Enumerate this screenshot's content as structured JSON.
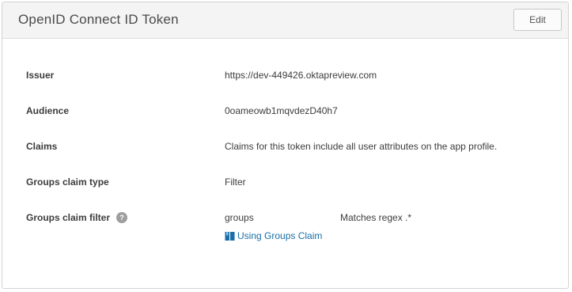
{
  "header": {
    "title": "OpenID Connect ID Token",
    "edit_label": "Edit"
  },
  "rows": [
    {
      "label": "Issuer",
      "value": "https://dev-449426.oktapreview.com"
    },
    {
      "label": "Audience",
      "value": "0oameowb1mqvdezD40h7"
    },
    {
      "label": "Claims",
      "value": "Claims for this token include all user attributes on the app profile."
    },
    {
      "label": "Groups claim type",
      "value": "Filter"
    },
    {
      "label": "Groups claim filter",
      "value": "groups",
      "match": "Matches regex .*",
      "help": "?"
    }
  ],
  "doc_link": {
    "label": "Using Groups Claim",
    "icon": "book-icon"
  },
  "colors": {
    "link": "#1a6ea8",
    "header_bg": "#f4f4f4",
    "border": "#d4d4d4"
  }
}
